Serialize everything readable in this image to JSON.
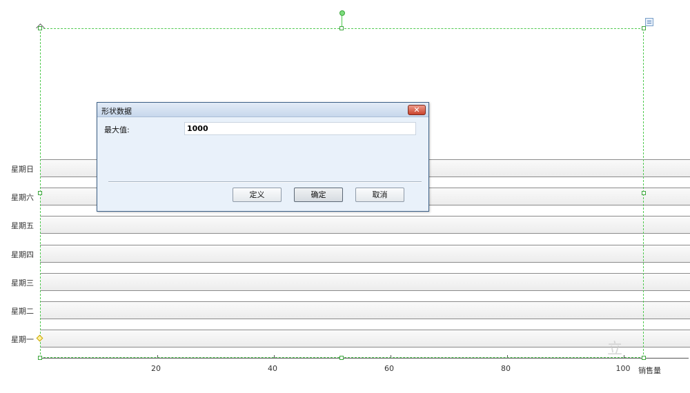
{
  "chart": {
    "categories": [
      "星期日",
      "星期六",
      "星期五",
      "星期四",
      "星期三",
      "星期二",
      "星期一"
    ],
    "x_ticks": [
      "20",
      "40",
      "60",
      "80",
      "100"
    ],
    "x_axis_label": "销售量"
  },
  "dialog": {
    "title": "形状数据",
    "close_label": "✕",
    "field_label": "最大值:",
    "field_value": "1000",
    "buttons": {
      "define": "定义",
      "ok": "确定",
      "cancel": "取消"
    }
  },
  "watermark": "立"
}
